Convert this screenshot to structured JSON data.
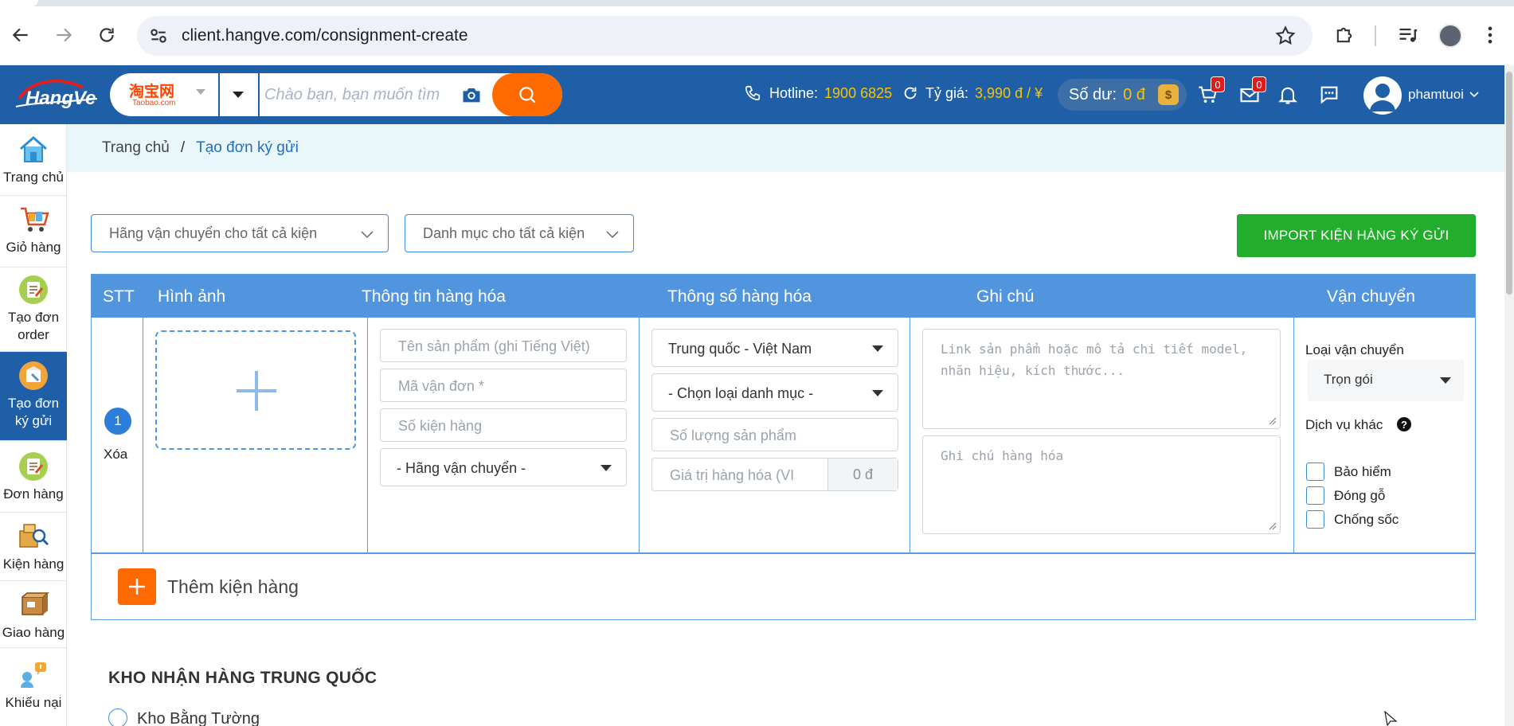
{
  "browser": {
    "url": "client.hangve.com/consignment-create"
  },
  "header": {
    "logo_text": "HangVe",
    "search": {
      "source_name": "淘宝网",
      "source_sub": "Taobao.com",
      "placeholder": "Chào bạn, bạn muốn tìm"
    },
    "hotline_label": "Hotline:",
    "hotline_value": "1900 6825",
    "rate_label": "Tỷ giá:",
    "rate_value": "3,990 đ / ¥",
    "balance_label": "Số dư:",
    "balance_value": "0 đ",
    "balance_coin": "$",
    "cart_count": "0",
    "mail_count": "0",
    "username": "phamtuoi"
  },
  "sidebar": {
    "items": [
      {
        "label": "Trang chủ",
        "icon": "home-icon"
      },
      {
        "label": "Giỏ hàng",
        "icon": "cart-icon"
      },
      {
        "label_line1": "Tạo đơn",
        "label_line2": "order",
        "icon": "order-create-icon"
      },
      {
        "label_line1": "Tạo đơn",
        "label_line2": "ký gửi",
        "icon": "consignment-icon"
      },
      {
        "label": "Đơn hàng",
        "icon": "orders-icon"
      },
      {
        "label": "Kiện hàng",
        "icon": "package-icon"
      },
      {
        "label": "Giao hàng",
        "icon": "delivery-icon"
      },
      {
        "label": "Khiếu nại",
        "icon": "complaint-icon"
      }
    ]
  },
  "breadcrumb": {
    "home": "Trang chủ",
    "separator": "/",
    "current": "Tạo đơn ký gửi"
  },
  "filters": {
    "carrier_all": "Hãng vận chuyển cho tất cả kiện",
    "category_all": "Danh mục cho tất cả kiện",
    "import_button": "IMPORT KIỆN HÀNG KÝ GỬI"
  },
  "table": {
    "headers": [
      "STT",
      "Hình ảnh",
      "Thông tin hàng hóa",
      "Thông số hàng hóa",
      "Ghi chú",
      "Vận chuyển"
    ],
    "row": {
      "index": "1",
      "delete_label": "Xóa",
      "product_name_placeholder": "Tên sản phẩm (ghi Tiếng Việt)",
      "tracking_placeholder": "Mã vận đơn *",
      "package_count_placeholder": "Số kiện hàng",
      "carrier_select": "- Hãng vận chuyển -",
      "route_select": "Trung quốc - Việt Nam",
      "category_select": "- Chọn loại danh mục -",
      "quantity_placeholder": "Số lượng sản phẩm",
      "value_placeholder": "Giá trị hàng hóa (VI",
      "value_suffix": "0 đ",
      "link_placeholder_line1": "Link sản phẩm hoặc mô tả chi tiết model,",
      "link_placeholder_line2": "nhãn hiệu, kích thước...",
      "note_placeholder": "Ghi chú hàng hóa",
      "shipping_type_label": "Loại vận chuyển",
      "shipping_type_value": "Trọn gói",
      "other_services_label": "Dịch vụ khác",
      "services": [
        "Bảo hiểm",
        "Đóng gỗ",
        "Chống sốc"
      ]
    }
  },
  "add_package_label": "Thêm kiện hàng",
  "warehouse": {
    "title": "KHO NHẬN HÀNG TRUNG QUỐC",
    "option": "Kho Bằng Tường"
  }
}
